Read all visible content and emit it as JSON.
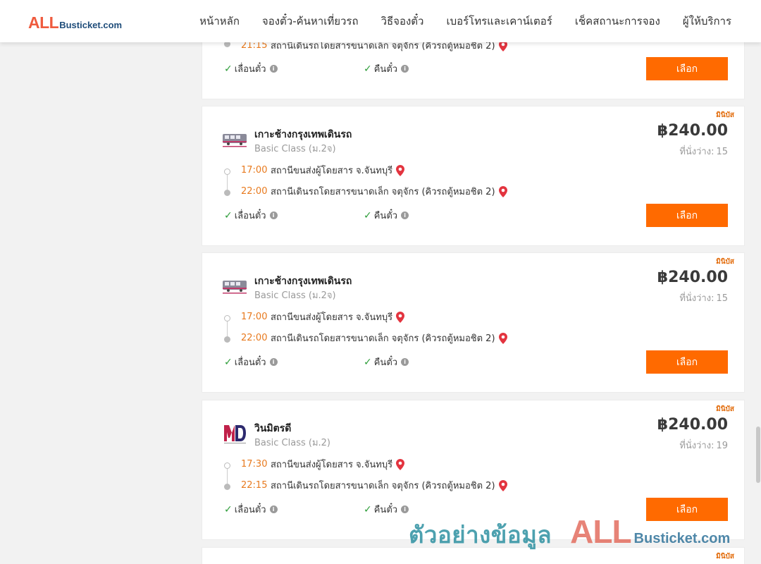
{
  "header": {
    "logo_all": "ALL",
    "logo_rest": "Busticket.com",
    "nav": [
      "หน้าหลัก",
      "จองตั๋ว-ค้นหาเที่ยวรถ",
      "วิธีจองตั๋ว",
      "เบอร์โทรและเคาน์เตอร์",
      "เช็คสถานะการจอง",
      "ผู้ให้บริการ"
    ]
  },
  "labels": {
    "reschedule": "เลื่อนตั๋ว",
    "refund": "คืนตั๋ว",
    "select": "เลือก",
    "badge": "มินิบัส",
    "seats_prefix": "ที่นั่งว่าง:"
  },
  "partial_top": {
    "time": "21:15",
    "place": "สถานีเดินรถโดยสารขนาดเล็ก จตุจักร (คิวรถตู้หมอชิต 2)"
  },
  "cards": [
    {
      "operator": "เกาะช้างกรุงเทพเดินรถ",
      "class": "Basic Class (ม.2จ)",
      "price": "฿240.00",
      "seats": "15",
      "depart_time": "17:00",
      "depart_place": "สถานีขนส่งผู้โดยสาร จ.จันทบุรี",
      "arrive_time": "22:00",
      "arrive_place": "สถานีเดินรถโดยสารขนาดเล็ก จตุจักร (คิวรถตู้หมอชิต 2)"
    },
    {
      "operator": "เกาะช้างกรุงเทพเดินรถ",
      "class": "Basic Class (ม.2จ)",
      "price": "฿240.00",
      "seats": "15",
      "depart_time": "17:00",
      "depart_place": "สถานีขนส่งผู้โดยสาร จ.จันทบุรี",
      "arrive_time": "22:00",
      "arrive_place": "สถานีเดินรถโดยสารขนาดเล็ก จตุจักร (คิวรถตู้หมอชิต 2)"
    },
    {
      "operator": "วินมิตรดี",
      "class": "Basic Class (ม.2)",
      "price": "฿240.00",
      "seats": "19",
      "depart_time": "17:30",
      "depart_place": "สถานีขนส่งผู้โดยสาร จ.จันทบุรี",
      "arrive_time": "22:15",
      "arrive_place": "สถานีเดินรถโดยสารขนาดเล็ก จตุจักร (คิวรถตู้หมอชิต 2)"
    }
  ],
  "watermark": {
    "thai": "ตัวอย่างข้อมูล",
    "all": "ALL",
    "rest": "Busticket.com"
  },
  "colors": {
    "accent": "#ff6a00",
    "time": "#e87a1e",
    "check": "#2e9d3a",
    "pin": "#e3343f"
  }
}
